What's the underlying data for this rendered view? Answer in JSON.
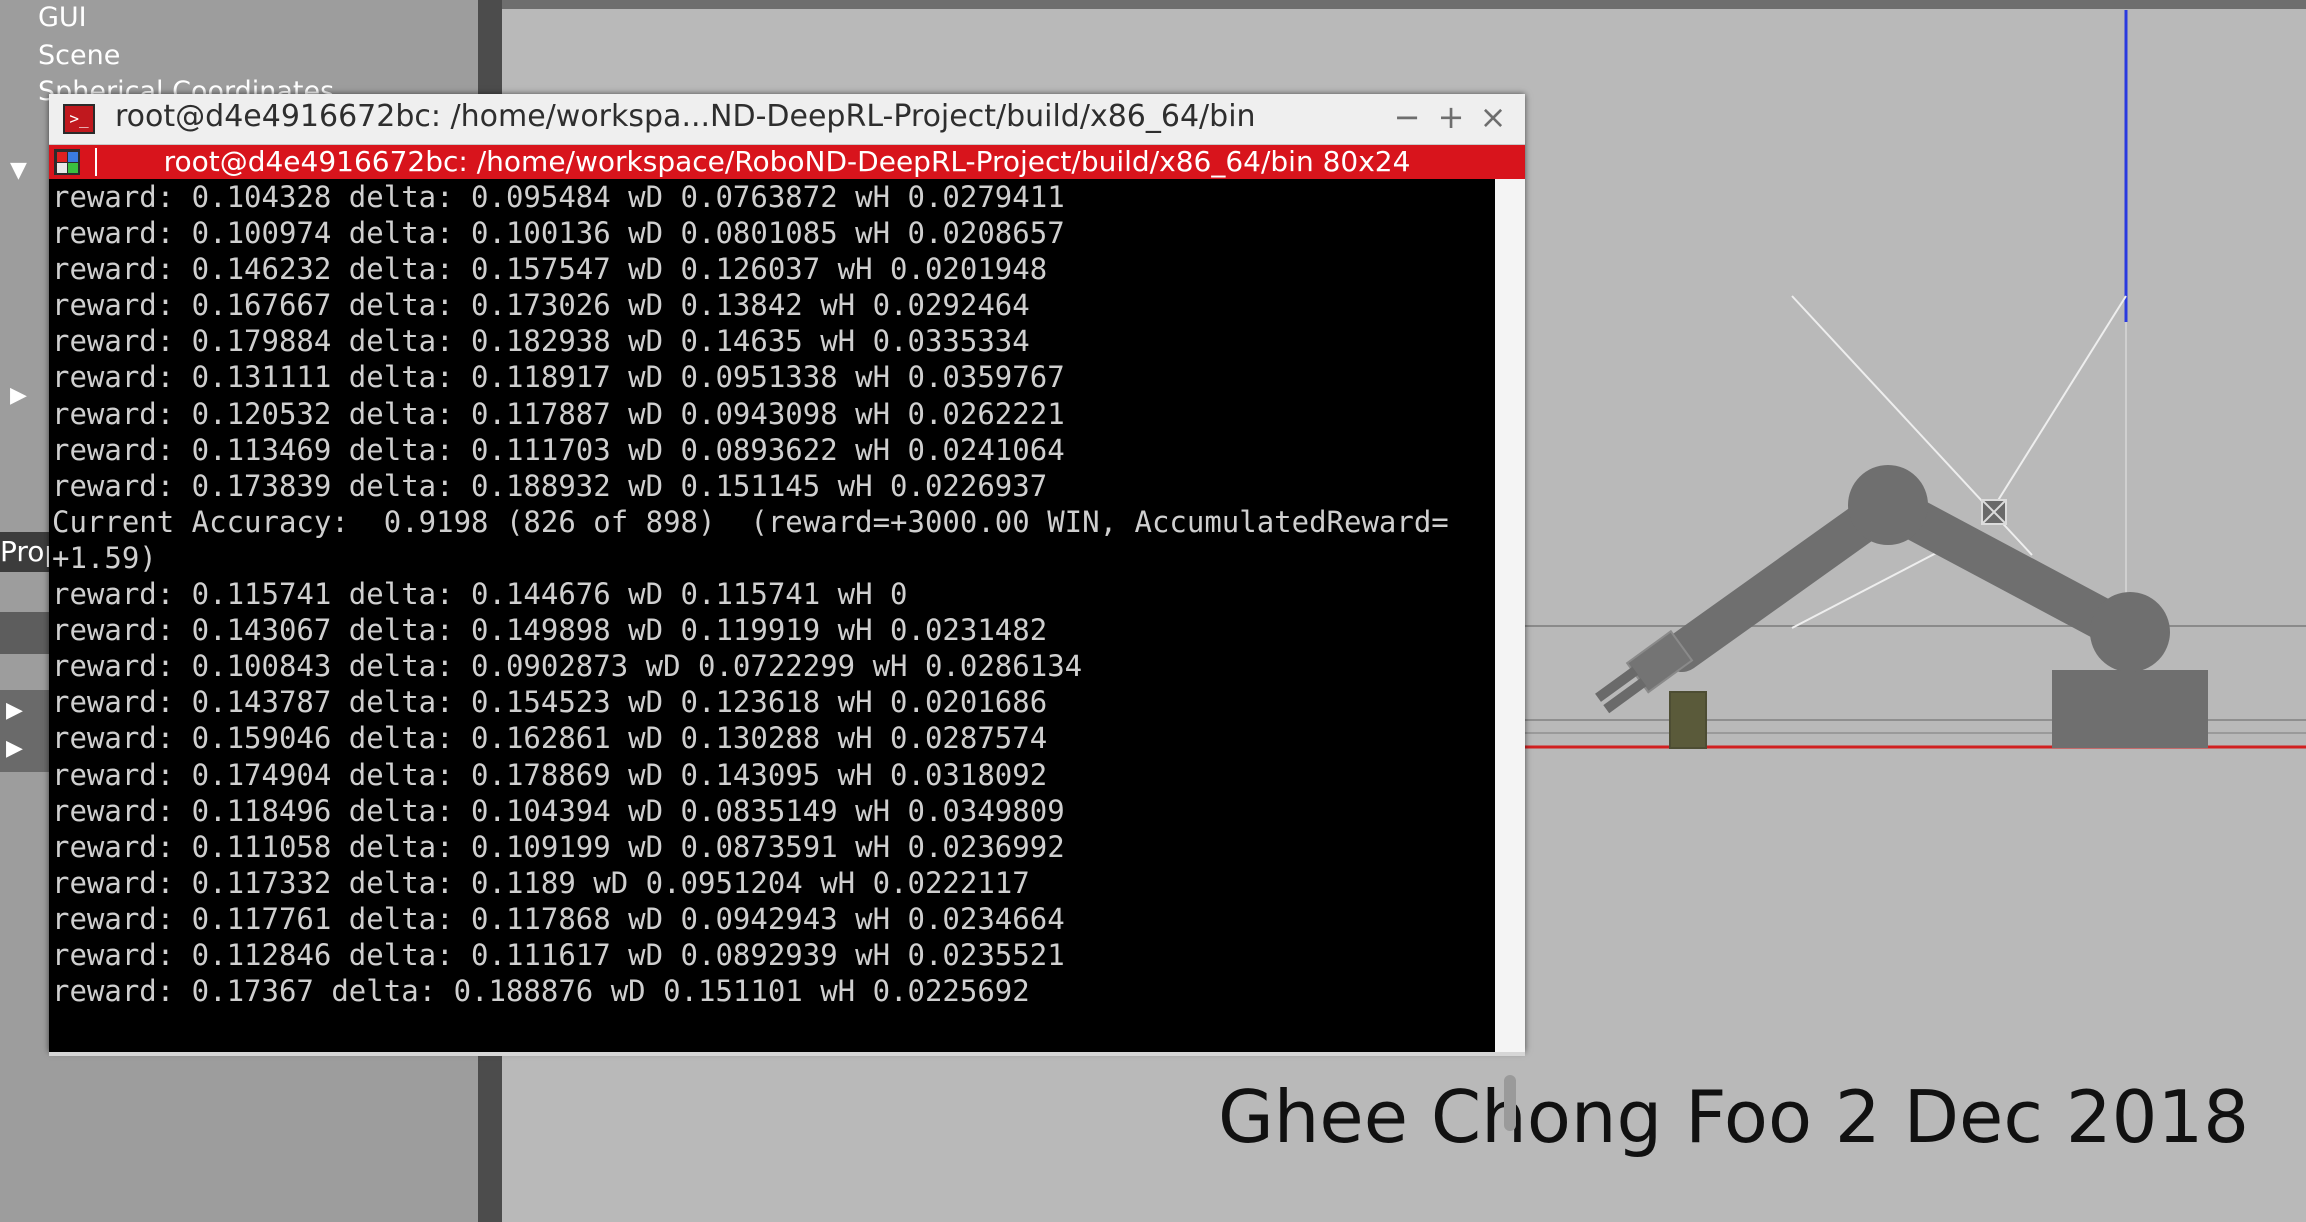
{
  "left_panel": {
    "tree_items": [
      "GUI",
      "Scene",
      "Spherical Coordinates"
    ],
    "props_label": "Prop"
  },
  "caption": "Ghee Chong Foo 2 Dec 2018",
  "terminal": {
    "window_title": "root@d4e4916672bc: /home/workspa...ND-DeepRL-Project/build/x86_64/bin",
    "tab_title": "root@d4e4916672bc: /home/workspace/RoboND-DeepRL-Project/build/x86_64/bin 80x24",
    "controls": {
      "minimize": "−",
      "maximize": "+",
      "close": "×"
    },
    "lines": [
      "reward: 0.104328 delta: 0.095484 wD 0.0763872 wH 0.0279411",
      "reward: 0.100974 delta: 0.100136 wD 0.0801085 wH 0.0208657",
      "reward: 0.146232 delta: 0.157547 wD 0.126037 wH 0.0201948",
      "reward: 0.167667 delta: 0.173026 wD 0.13842 wH 0.0292464",
      "reward: 0.179884 delta: 0.182938 wD 0.14635 wH 0.0335334",
      "reward: 0.131111 delta: 0.118917 wD 0.0951338 wH 0.0359767",
      "reward: 0.120532 delta: 0.117887 wD 0.0943098 wH 0.0262221",
      "reward: 0.113469 delta: 0.111703 wD 0.0893622 wH 0.0241064",
      "reward: 0.173839 delta: 0.188932 wD 0.151145 wH 0.0226937",
      "Current Accuracy:  0.9198 (826 of 898)  (reward=+3000.00 WIN, AccumulatedReward=",
      "+1.59)",
      "reward: 0.115741 delta: 0.144676 wD 0.115741 wH 0",
      "reward: 0.143067 delta: 0.149898 wD 0.119919 wH 0.0231482",
      "reward: 0.100843 delta: 0.0902873 wD 0.0722299 wH 0.0286134",
      "reward: 0.143787 delta: 0.154523 wD 0.123618 wH 0.0201686",
      "reward: 0.159046 delta: 0.162861 wD 0.130288 wH 0.0287574",
      "reward: 0.174904 delta: 0.178869 wD 0.143095 wH 0.0318092",
      "reward: 0.118496 delta: 0.104394 wD 0.0835149 wH 0.0349809",
      "reward: 0.111058 delta: 0.109199 wD 0.0873591 wH 0.0236992",
      "reward: 0.117332 delta: 0.1189 wD 0.0951204 wH 0.0222117",
      "reward: 0.117761 delta: 0.117868 wD 0.0942943 wH 0.0234664",
      "reward: 0.112846 delta: 0.111617 wD 0.0892939 wH 0.0235521",
      "reward: 0.17367 delta: 0.188876 wD 0.151101 wH 0.0225692"
    ]
  },
  "colors": {
    "terminal_tab_bar": "#d8141c",
    "terminal_bg": "#000000",
    "terminal_text": "#cfcfcf",
    "scene_bg": "#b9b9b9",
    "robot_arm": "#6f6f6f",
    "target_tube": "#5a5a3a"
  }
}
